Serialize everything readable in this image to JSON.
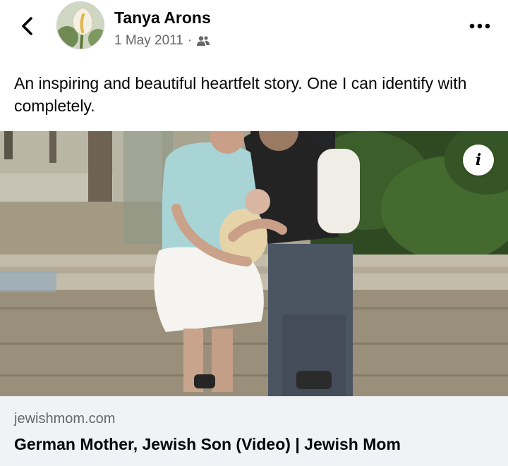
{
  "post": {
    "author": "Tanya Arons",
    "date": "1 May 2011",
    "separator": "·",
    "audience_icon": "friends-icon",
    "text": "An inspiring and beautiful heartfelt story.  One I can identify with completely."
  },
  "link_preview": {
    "domain": "jewishmom.com",
    "title": "German Mother, Jewish Son (Video) | Jewish Mom"
  },
  "icons": {
    "back": "chevron-left-icon",
    "more": "more-options-icon",
    "info": "info-icon"
  },
  "colors": {
    "primary_text": "#050505",
    "secondary_text": "#65676b",
    "card_background": "#f0f2f5"
  }
}
